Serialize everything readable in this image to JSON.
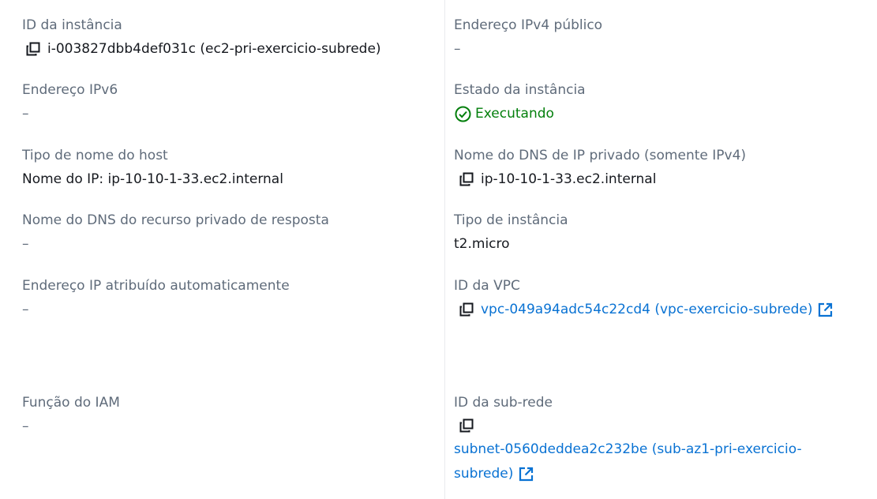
{
  "left": {
    "instance_id": {
      "label": "ID da instância",
      "value": "i-003827dbb4def031c (ec2-pri-exercicio-subrede)"
    },
    "ipv6": {
      "label": "Endereço IPv6",
      "value": "–"
    },
    "hostname_type": {
      "label": "Tipo de nome do host",
      "value": "Nome do IP: ip-10-10-1-33.ec2.internal"
    },
    "private_resource_dns": {
      "label": "Nome do DNS do recurso privado de resposta",
      "value": "–"
    },
    "auto_ip": {
      "label": "Endereço IP atribuído automaticamente",
      "value": "–"
    },
    "iam_role": {
      "label": "Função do IAM",
      "value": "–"
    }
  },
  "right": {
    "public_ipv4": {
      "label": "Endereço IPv4 público",
      "value": "–"
    },
    "instance_state": {
      "label": "Estado da instância",
      "value": "Executando"
    },
    "private_dns": {
      "label": "Nome do DNS de IP privado (somente IPv4)",
      "value": "ip-10-10-1-33.ec2.internal"
    },
    "instance_type": {
      "label": "Tipo de instância",
      "value": "t2.micro"
    },
    "vpc_id": {
      "label": "ID da VPC",
      "value": "vpc-049a94adc54c22cd4 (vpc-exercicio-subrede)"
    },
    "subnet_id": {
      "label": "ID da sub-rede",
      "value_line1": "subnet-0560deddea2c232be (sub-az1-pri-exercicio-",
      "value_line2": "subrede)"
    }
  },
  "colors": {
    "label": "#5f6b7a",
    "text": "#16191f",
    "link": "#0972d3",
    "success": "#037f0c",
    "divider": "#e9ebed"
  }
}
